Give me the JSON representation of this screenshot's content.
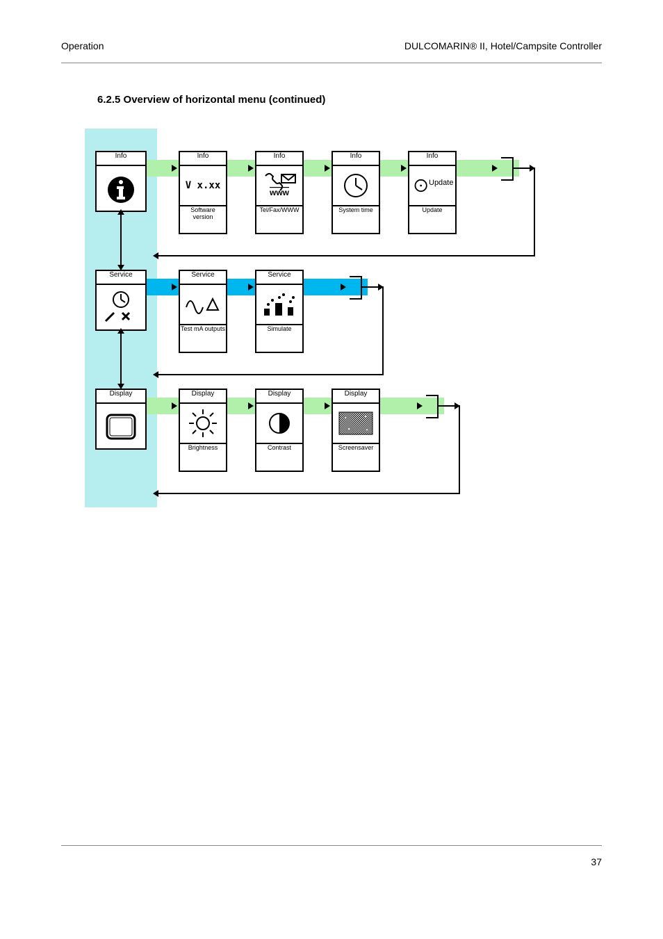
{
  "header": {
    "section": "Operation",
    "product": "DULCOMARIN® II, Hotel/Campsite Controller"
  },
  "footer": {
    "page": "37"
  },
  "heading": "6.2.5 Overview of horizontal menu (continued)",
  "sidebar": [
    {
      "label": "Info",
      "name": "info-icon"
    },
    {
      "label": "Service",
      "name": "service-icon"
    },
    {
      "label": "Display",
      "name": "display-icon"
    }
  ],
  "rows": [
    {
      "band_color": "#b0f0aa",
      "items": [
        {
          "hdr": "Info",
          "name": "version-icon",
          "ftr": "Software version"
        },
        {
          "hdr": "Info",
          "name": "www-icon",
          "ftr": "Tel/Fax/WWW"
        },
        {
          "hdr": "Info",
          "name": "clock-icon",
          "ftr": "System time"
        },
        {
          "hdr": "Info",
          "name": "update-icon",
          "ftr": "Update",
          "label": "Update"
        }
      ]
    },
    {
      "band_color": "#00b6ef",
      "items": [
        {
          "hdr": "Service",
          "name": "waveform-icon",
          "ftr": "Test mA outputs"
        },
        {
          "hdr": "Service",
          "name": "simulate-icon",
          "ftr": "Simulate"
        }
      ]
    },
    {
      "band_color": "#b0f0aa",
      "items": [
        {
          "hdr": "Display",
          "name": "brightness-icon",
          "ftr": "Brightness"
        },
        {
          "hdr": "Display",
          "name": "contrast-icon",
          "ftr": "Contrast"
        },
        {
          "hdr": "Display",
          "name": "screensaver-icon",
          "ftr": "Screensaver"
        }
      ]
    }
  ],
  "icon_text": {
    "version": "V x.xx",
    "www": "www",
    "update": "Update"
  }
}
